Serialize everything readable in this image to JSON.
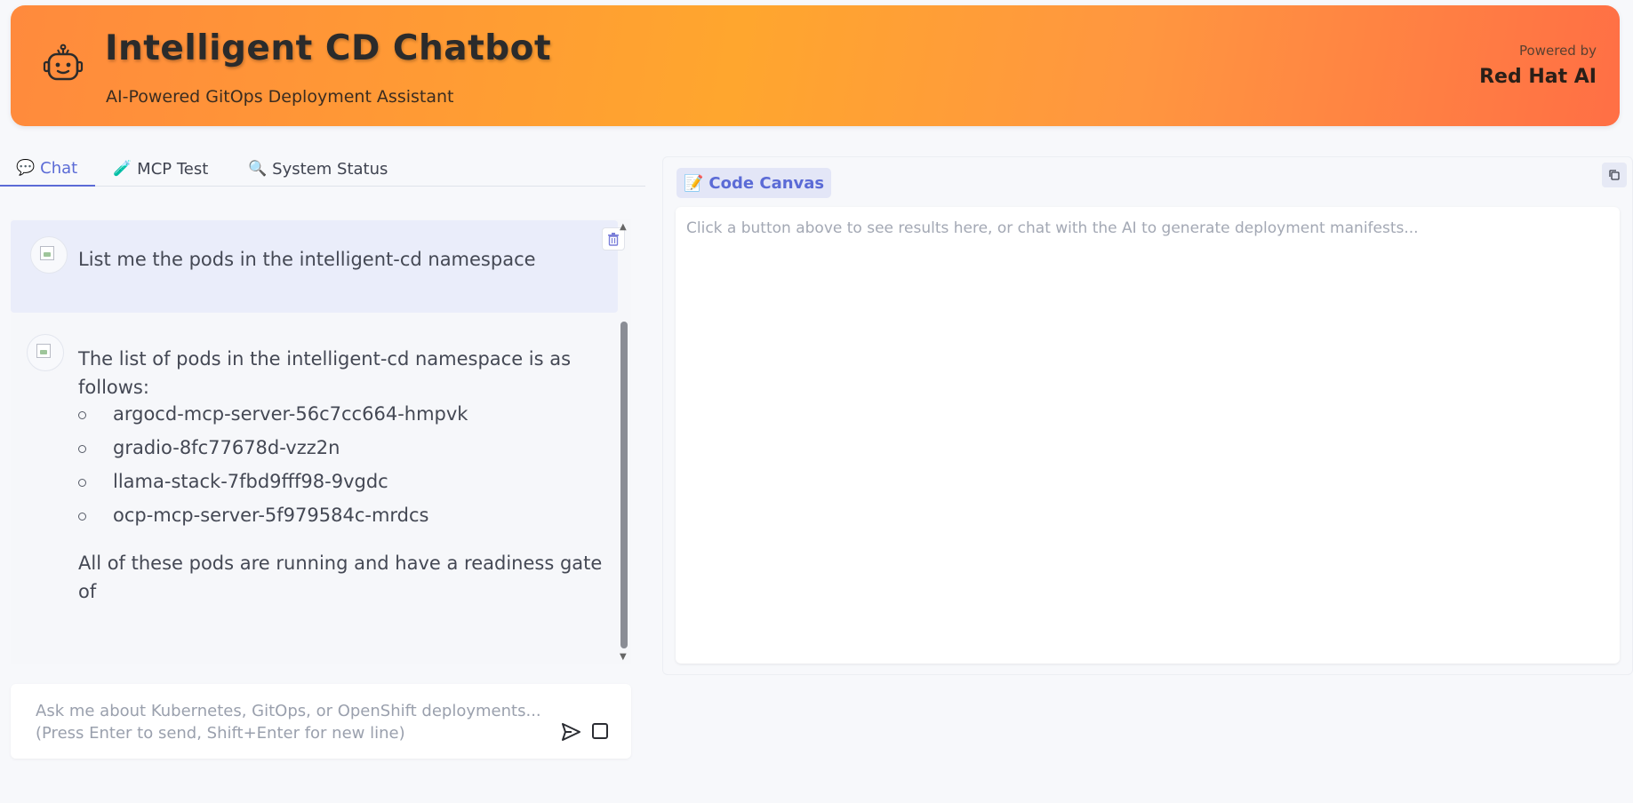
{
  "header": {
    "title": "Intelligent CD Chatbot",
    "subtitle": "AI-Powered GitOps Deployment Assistant",
    "powered_label": "Powered by",
    "powered_name": "Red Hat AI",
    "logo_icon": "robot-icon"
  },
  "tabs": [
    {
      "icon": "💬",
      "label": "Chat",
      "active": true
    },
    {
      "icon": "🧪",
      "label": "MCP Test",
      "active": false
    },
    {
      "icon": "🔍",
      "label": "System Status",
      "active": false
    }
  ],
  "chat": {
    "user_message": "List me the pods in the intelligent-cd namespace",
    "bot_intro": "The list of pods in the intelligent-cd namespace is as follows:",
    "pods": [
      "argocd-mcp-server-56c7cc664-hmpvk",
      "gradio-8fc77678d-vzz2n",
      "llama-stack-7fbd9fff98-9vgdc",
      "ocp-mcp-server-5f979584c-mrdcs"
    ],
    "bot_outro": "All of these pods are running and have a readiness gate of"
  },
  "input": {
    "placeholder": "Ask me about Kubernetes, GitOps, or OpenShift deployments... (Press Enter to send, Shift+Enter for new line)"
  },
  "canvas": {
    "icon": "📝",
    "label": "Code Canvas",
    "placeholder": "Click a button above to see results here, or chat with the AI to generate deployment manifests..."
  },
  "colors": {
    "accent": "#5b6bd6",
    "header_gradient_start": "#ff8a3d",
    "header_gradient_end": "#ff6f45"
  }
}
